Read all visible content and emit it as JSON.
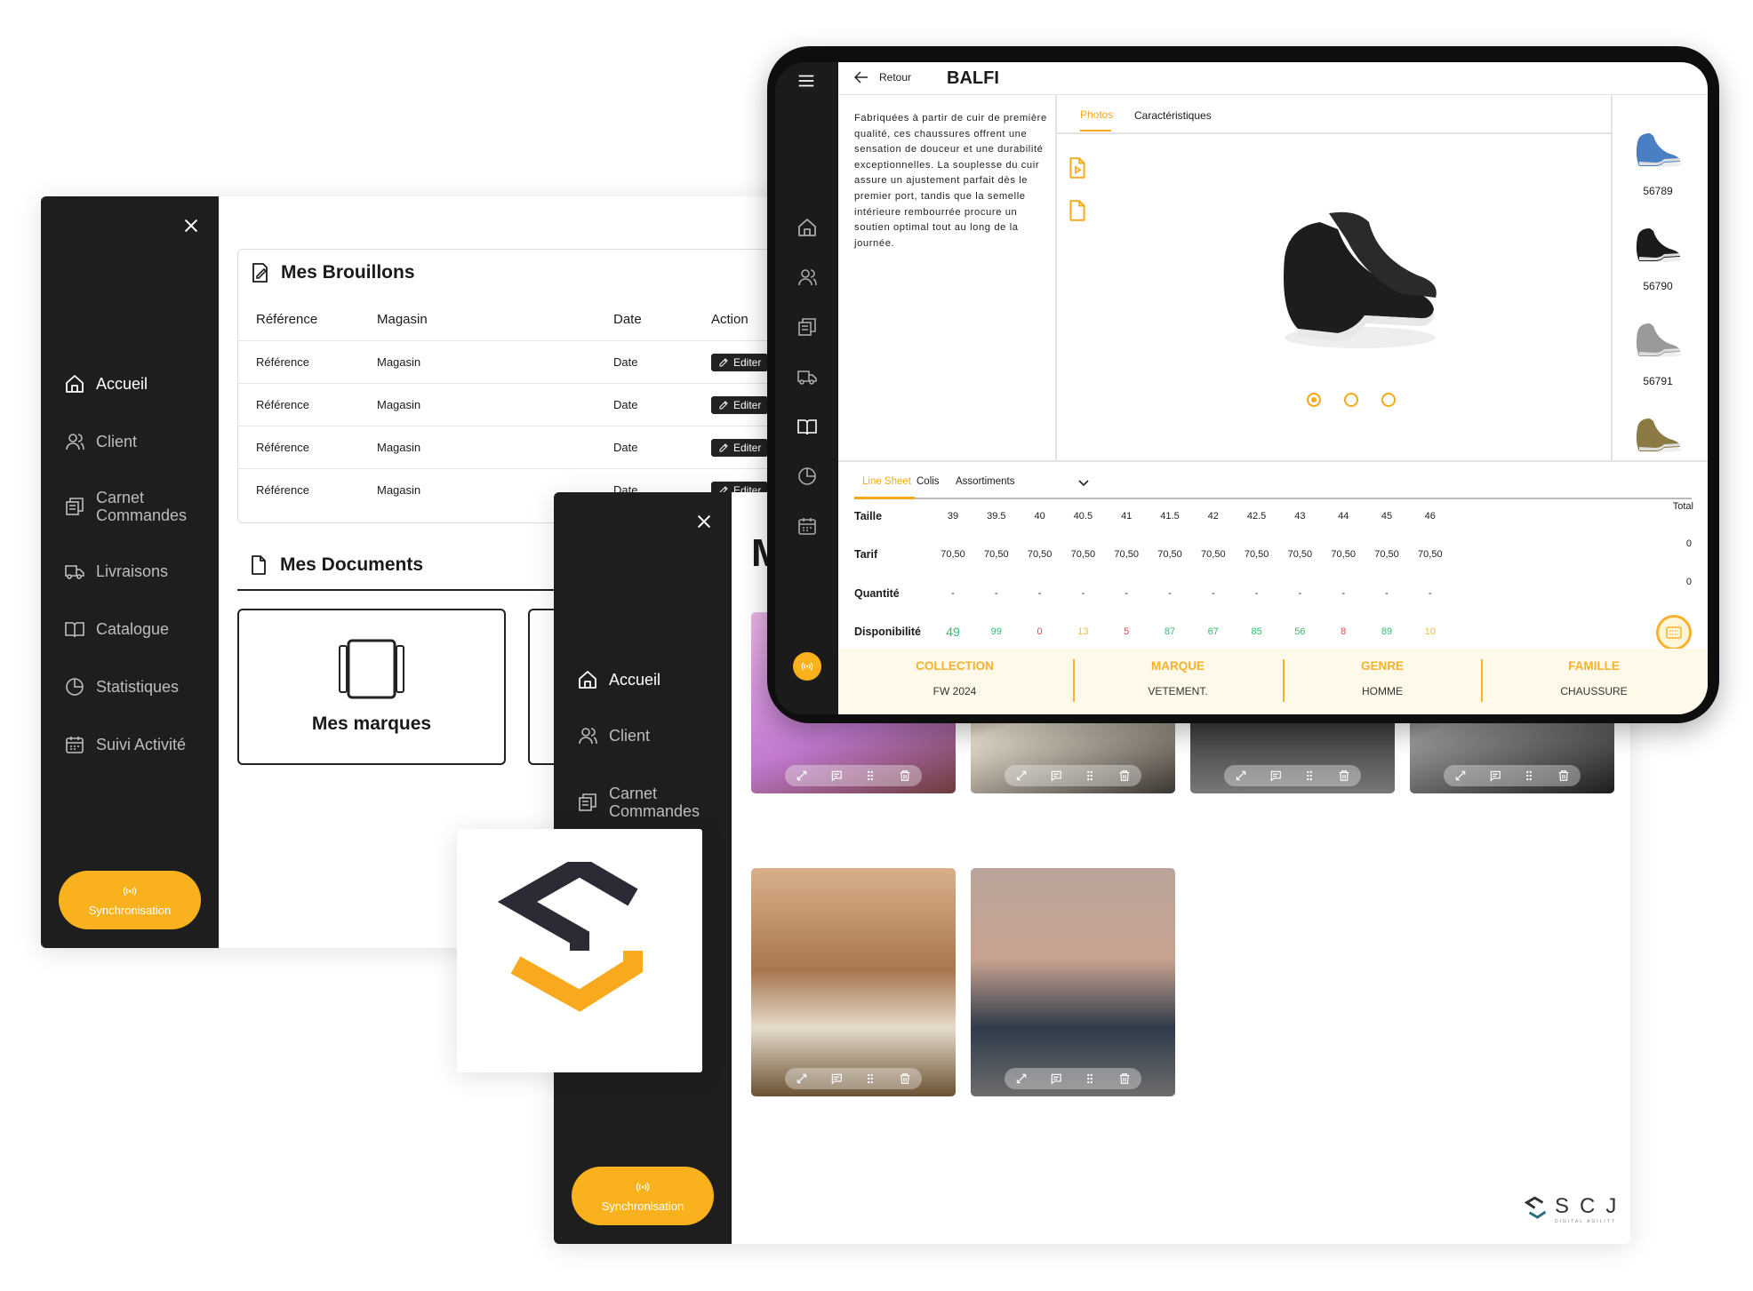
{
  "colors": {
    "accent": "#f9b21d",
    "sidebar": "#1e1e1e",
    "green": "#2fbf71",
    "red": "#e8424f",
    "yellow": "#f2c230"
  },
  "nav_items": [
    {
      "label": "Accueil",
      "icon": "home-icon"
    },
    {
      "label": "Client",
      "icon": "user-icon"
    },
    {
      "label": "Carnet Commandes",
      "icon": "orders-icon"
    },
    {
      "label": "Livraisons",
      "icon": "truck-icon"
    },
    {
      "label": "Catalogue",
      "icon": "book-icon"
    },
    {
      "label": "Statistiques",
      "icon": "pie-chart-icon"
    },
    {
      "label": "Suivi Activité",
      "icon": "calendar-icon"
    }
  ],
  "sync_label": "Synchronisation",
  "drafts": {
    "title": "Mes Brouillons",
    "headers": [
      "Référence",
      "Magasin",
      "Date",
      "Action"
    ],
    "rows": [
      {
        "ref": "Référence",
        "store": "Magasin",
        "date": "Date",
        "action": "Editer"
      },
      {
        "ref": "Référence",
        "store": "Magasin",
        "date": "Date",
        "action": "Editer"
      },
      {
        "ref": "Référence",
        "store": "Magasin",
        "date": "Date",
        "action": "Editer"
      },
      {
        "ref": "Référence",
        "store": "Magasin",
        "date": "Date",
        "action": "Editer"
      }
    ]
  },
  "documents": {
    "title": "Mes Documents",
    "cards": [
      "Mes marques"
    ]
  },
  "catalog": {
    "title_initial": "M"
  },
  "brand": {
    "name": "SCJ",
    "tagline": "DIGITAL AGILITY"
  },
  "product": {
    "back_label": "Retour",
    "name": "BALFI",
    "description": "Fabriquées à partir de cuir de première qualité, ces chaussures offrent une sensation de douceur et une durabilité exceptionnelles. La souplesse du cuir assure un ajustement parfait dès le premier port, tandis que la semelle intérieure rembourrée procure un soutien optimal tout au long de la journée.",
    "media_tabs": [
      "Photos",
      "Caractéristiques"
    ],
    "active_media_tab": "Photos",
    "carousel": {
      "slides": 3,
      "active": 0
    },
    "variants": [
      {
        "ref": "56789",
        "color": "#4a7fc4"
      },
      {
        "ref": "56790",
        "color": "#1b1b1b"
      },
      {
        "ref": "56791",
        "color": "#9a9a9a"
      },
      {
        "ref": "",
        "color": "#8c7a45"
      }
    ],
    "sheet_tabs": [
      "Line Sheet",
      "Colis",
      "Assortiments"
    ],
    "active_sheet_tab": "Line Sheet",
    "row_labels": {
      "size": "Taille",
      "price": "Tarif",
      "qty": "Quantité",
      "avail": "Disponibilité",
      "total": "Total"
    },
    "sizes": [
      "39",
      "39.5",
      "40",
      "40.5",
      "41",
      "41.5",
      "42",
      "42.5",
      "43",
      "44",
      "45",
      "46"
    ],
    "prices": [
      "70,50",
      "70,50",
      "70,50",
      "70,50",
      "70,50",
      "70,50",
      "70,50",
      "70,50",
      "70,50",
      "70,50",
      "70,50",
      "70,50"
    ],
    "quantities": [
      "-",
      "-",
      "-",
      "-",
      "-",
      "-",
      "-",
      "-",
      "-",
      "-",
      "-",
      "-"
    ],
    "availability": [
      49,
      99,
      0,
      13,
      5,
      87,
      67,
      85,
      56,
      8,
      89,
      10
    ],
    "totals": {
      "price": "0",
      "qty": "0"
    },
    "attributes": [
      {
        "key": "COLLECTION",
        "value": "FW 2024"
      },
      {
        "key": "MARQUE",
        "value": "VETEMENT."
      },
      {
        "key": "GENRE",
        "value": "HOMME"
      },
      {
        "key": "FAMILLE",
        "value": "CHAUSSURE"
      }
    ]
  }
}
